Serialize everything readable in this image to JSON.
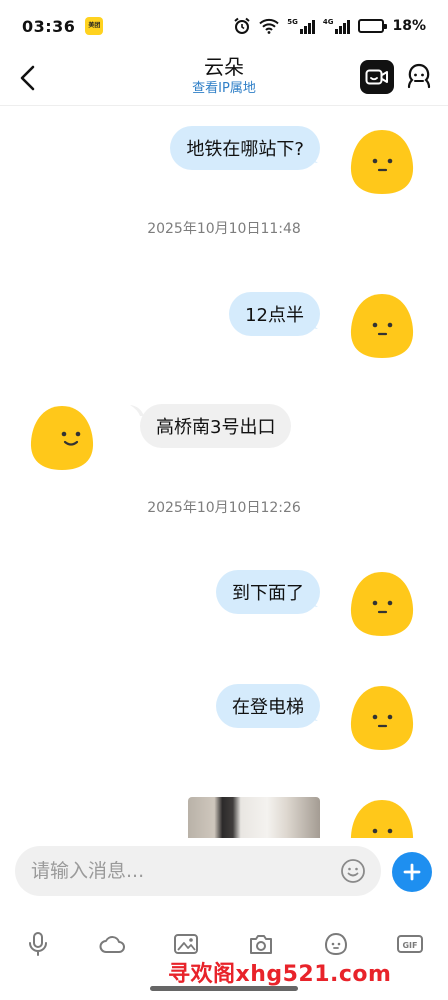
{
  "status_bar": {
    "time": "03:36",
    "app_badge": "美团",
    "network_5g": "5G",
    "network_4g": "4G",
    "battery_percent_text": "18%",
    "battery_level": 0.18,
    "battery_color": "#e02020"
  },
  "header": {
    "title": "云朵",
    "subtitle": "查看IP属地",
    "back_icon": "chevron-left-icon",
    "video_icon": "video-call-icon",
    "profile_icon": "profile-face-icon"
  },
  "messages": [
    {
      "type": "outgoing",
      "text": "地铁在哪站下?"
    },
    {
      "type": "timestamp",
      "text": "2025年10月10日11:48"
    },
    {
      "type": "outgoing",
      "text": "12点半"
    },
    {
      "type": "incoming",
      "text": "高桥南3号出口"
    },
    {
      "type": "timestamp",
      "text": "2025年10月10日12:26"
    },
    {
      "type": "outgoing",
      "text": "到下面了"
    },
    {
      "type": "outgoing",
      "text": "在登电梯"
    },
    {
      "type": "outgoing-image"
    }
  ],
  "input": {
    "placeholder": "请输入消息...",
    "value": ""
  },
  "toolbar": {
    "items": [
      "microphone-icon",
      "cloud-icon",
      "image-icon",
      "camera-icon",
      "emoji-face-icon",
      "gif-icon"
    ]
  },
  "watermark": {
    "text": "寻欢阁xhg521.com"
  },
  "colors": {
    "accent": "#1e8ff0",
    "outgoing_bubble": "#d5ebfc",
    "incoming_bubble": "#f0f0f0",
    "avatar_yellow": "#ffc81a",
    "watermark": "#e8232a"
  }
}
